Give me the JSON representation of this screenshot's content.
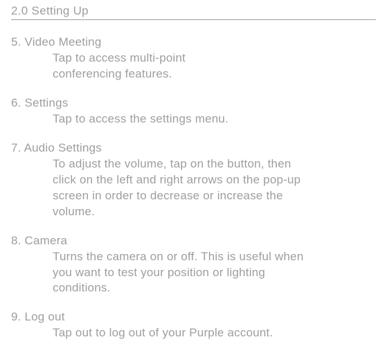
{
  "header": {
    "title": "2.0 Setting Up"
  },
  "items": {
    "i5": {
      "title": "5. Video Meeting",
      "desc": "Tap to access multi-point conferencing features."
    },
    "i6": {
      "title": "6. Settings",
      "desc": "Tap to access the settings menu."
    },
    "i7": {
      "title": "7. Audio Settings",
      "desc": "To adjust the volume, tap on the button, then click on the left and right arrows on the pop-up screen in order to decrease or increase the volume."
    },
    "i8": {
      "title": "8. Camera",
      "desc": "Turns the camera on or off. This is useful when you want to test your position or lighting conditions."
    },
    "i9": {
      "title": "9. Log out",
      "desc": "Tap out to log out of your Purple account."
    }
  }
}
